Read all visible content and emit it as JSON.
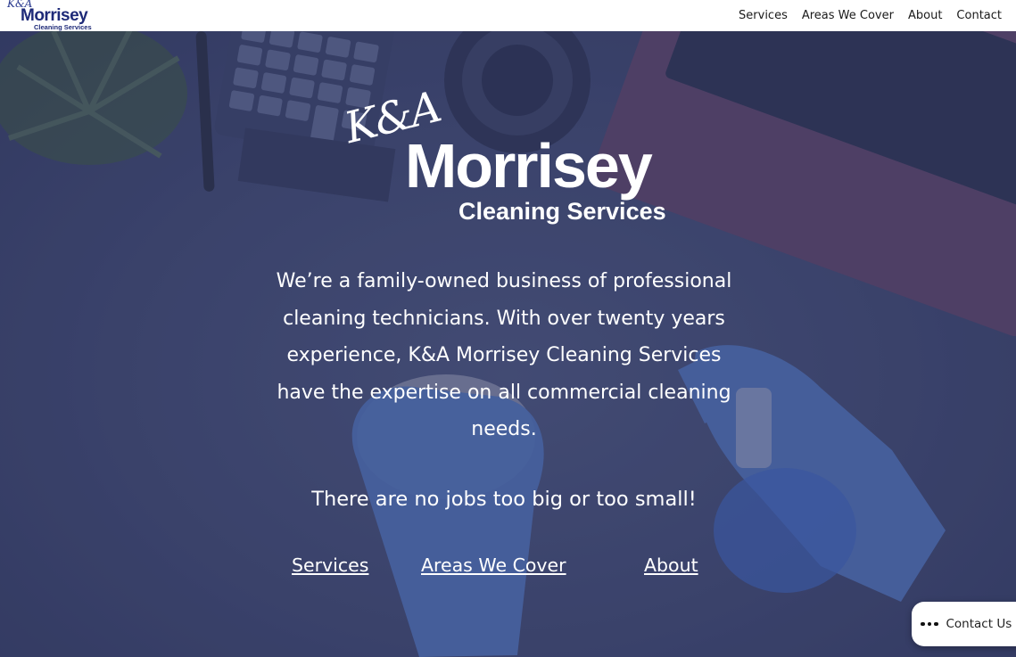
{
  "header": {
    "logo": {
      "ka": "K&A",
      "name": "Morrisey",
      "sub": "Cleaning Services"
    },
    "nav": [
      {
        "label": "Services"
      },
      {
        "label": "Areas We Cover"
      },
      {
        "label": "About"
      },
      {
        "label": "Contact"
      }
    ]
  },
  "hero": {
    "logo": {
      "ka": "K&A",
      "name": "Morrisey",
      "sub": "Cleaning Services"
    },
    "intro": "We’re a family-owned business of professional cleaning technicians. With over twenty years experience, K&A Morrisey Cleaning Services have the expertise on all commercial cleaning needs.",
    "tagline": "There are no jobs too big or too small!",
    "links": [
      {
        "label": "Services"
      },
      {
        "label": "Areas We Cover"
      },
      {
        "label": "About"
      }
    ]
  },
  "contact_widget": {
    "label": "Contact Us",
    "icon": "more-dots-icon"
  },
  "colors": {
    "overlay": "#3d4670",
    "text": "#ffffff",
    "brand": "#1e2a78"
  }
}
